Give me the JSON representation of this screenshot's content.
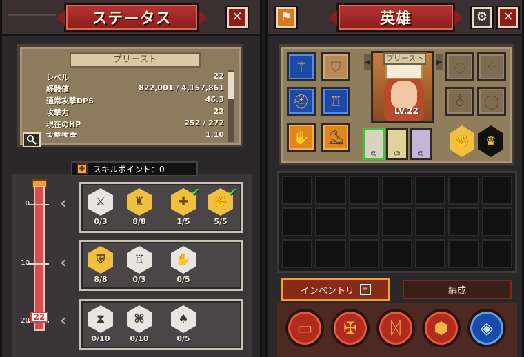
{
  "status_panel": {
    "title": "ステータス",
    "close_glyph": "✕",
    "class_tab": "プリースト",
    "stats": [
      {
        "label": "レベル",
        "value": "22"
      },
      {
        "label": "経験値",
        "value": "822,001 / 4,157,861"
      },
      {
        "label": "通常攻撃DPS",
        "value": "46.3"
      },
      {
        "label": "攻撃力",
        "value": "22"
      },
      {
        "label": "現在のHP",
        "value": "252 / 272"
      },
      {
        "label": "攻撃速度",
        "value": "1.10"
      }
    ],
    "skill_points_label": "スキルポイント：0",
    "gauge_ticks": [
      "0",
      "10",
      "20"
    ],
    "current_level_badge": "22",
    "skill_rows": [
      {
        "skills": [
          {
            "icon": "sword-icon",
            "glyph": "⚔",
            "count": "0/3",
            "style": "grey",
            "checked": false
          },
          {
            "icon": "helmet-icon",
            "glyph": "♜",
            "count": "8/8",
            "style": "gold",
            "checked": false
          },
          {
            "icon": "cross-icon",
            "glyph": "✚",
            "count": "1/5",
            "style": "gold",
            "checked": true
          },
          {
            "icon": "fist-icon",
            "glyph": "✊",
            "count": "5/5",
            "style": "gold",
            "checked": true
          }
        ]
      },
      {
        "skills": [
          {
            "icon": "shield-icon",
            "glyph": "⛨",
            "count": "8/8",
            "style": "gold",
            "checked": false
          },
          {
            "icon": "armor-icon",
            "glyph": "♖",
            "count": "0/3",
            "style": "grey",
            "checked": false
          },
          {
            "icon": "heal-hands-icon",
            "glyph": "✋",
            "count": "0/5",
            "style": "grey",
            "checked": false
          }
        ]
      },
      {
        "skills": [
          {
            "icon": "hourglass-icon",
            "glyph": "⧗",
            "count": "0/10",
            "style": "grey",
            "checked": false
          },
          {
            "icon": "map-icon",
            "glyph": "⌘",
            "count": "0/10",
            "style": "grey",
            "checked": false
          },
          {
            "icon": "spade-icon",
            "glyph": "♠",
            "count": "0/5",
            "style": "grey",
            "checked": false
          }
        ]
      }
    ]
  },
  "hero_panel": {
    "title": "英雄",
    "close_glyph": "✕",
    "hero_name": "プリースト",
    "hero_level": "LV.22",
    "equipment": [
      {
        "name": "staff-slot",
        "glyph": "⚚",
        "style": "blue"
      },
      {
        "name": "shield-slot",
        "glyph": "⛉",
        "style": "brown"
      },
      {
        "name": "helmet-slot",
        "glyph": "⛑",
        "style": "blue"
      },
      {
        "name": "armor-slot",
        "glyph": "♖",
        "style": "blue"
      },
      {
        "name": "gauntlet-slot",
        "glyph": "✋",
        "style": "orange"
      },
      {
        "name": "boots-slot",
        "glyph": "⛸",
        "style": "orange"
      }
    ],
    "accessory_slots": [
      {
        "name": "necklace-slot",
        "glyph": "◌"
      },
      {
        "name": "earrings-slot",
        "glyph": "⁘"
      },
      {
        "name": "bag-slot",
        "glyph": "♁"
      },
      {
        "name": "ring-slot",
        "glyph": "◯"
      }
    ],
    "inventory_tab": "インベントリ",
    "formation_tab": "編成",
    "bottom_buttons": [
      {
        "name": "chest-button",
        "glyph": "▭"
      },
      {
        "name": "cross-button",
        "glyph": "✠"
      },
      {
        "name": "rune-button",
        "glyph": "ᛞ"
      },
      {
        "name": "cube-button",
        "glyph": "⬢"
      },
      {
        "name": "gem-button",
        "glyph": "◈"
      }
    ]
  }
}
